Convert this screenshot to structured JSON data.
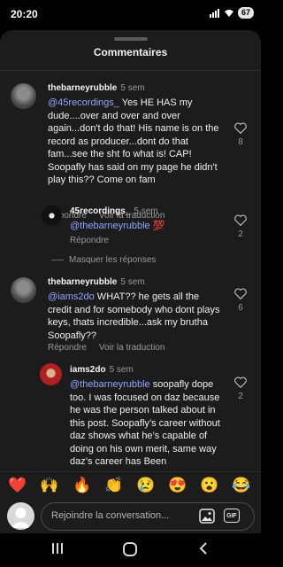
{
  "status": {
    "time": "20:20",
    "battery": "67"
  },
  "sheet": {
    "title": "Commentaires"
  },
  "comments": [
    {
      "user": "thebarneyrubble",
      "time": "5 sem",
      "mention": "@45recordings_",
      "text": " Yes HE HAS my dude....over and over and over again...don't do that! His name is on the record as producer...dont do that fam...see the sht fo what is! CAP! Soopafly has said on my page he didn't play this?? Come on fam",
      "reply_label": "Répondre",
      "translate_label": "Voir la traduction",
      "likes": "8"
    },
    {
      "user": "45recordings_",
      "time": "5 sem",
      "mention": "@thebarneyrubble",
      "text": " 💯",
      "reply_label": "Répondre",
      "likes": "2"
    },
    {
      "user": "thebarneyrubble",
      "time": "5 sem",
      "mention": "@iams2do",
      "text": " WHAT?? he gets all the credit and for somebody who dont plays keys, thats incredible...ask my brutha Soopafly??",
      "reply_label": "Répondre",
      "translate_label": "Voir la traduction",
      "likes": "6"
    },
    {
      "user": "iams2do",
      "time": "5 sem",
      "mention": "@thebarneyrubble",
      "text": " soopafly dope too. I was focused on daz because he was the person talked about in this post. Soopafly’s career without daz shows what he’s capable of doing on his own merit, same way daz’s career has Been",
      "likes": "2"
    }
  ],
  "hide_replies_label": "Masquer les réponses",
  "emojis": [
    "❤️",
    "🙌",
    "🔥",
    "👏",
    "😢",
    "😍",
    "😮",
    "😂"
  ],
  "input": {
    "placeholder": "Rejoindre la conversation...",
    "gif_label": "GIF"
  },
  "colors": {
    "background": "#1c1c1d",
    "mention": "#8fa5ff",
    "muted": "#9a9a9a"
  }
}
